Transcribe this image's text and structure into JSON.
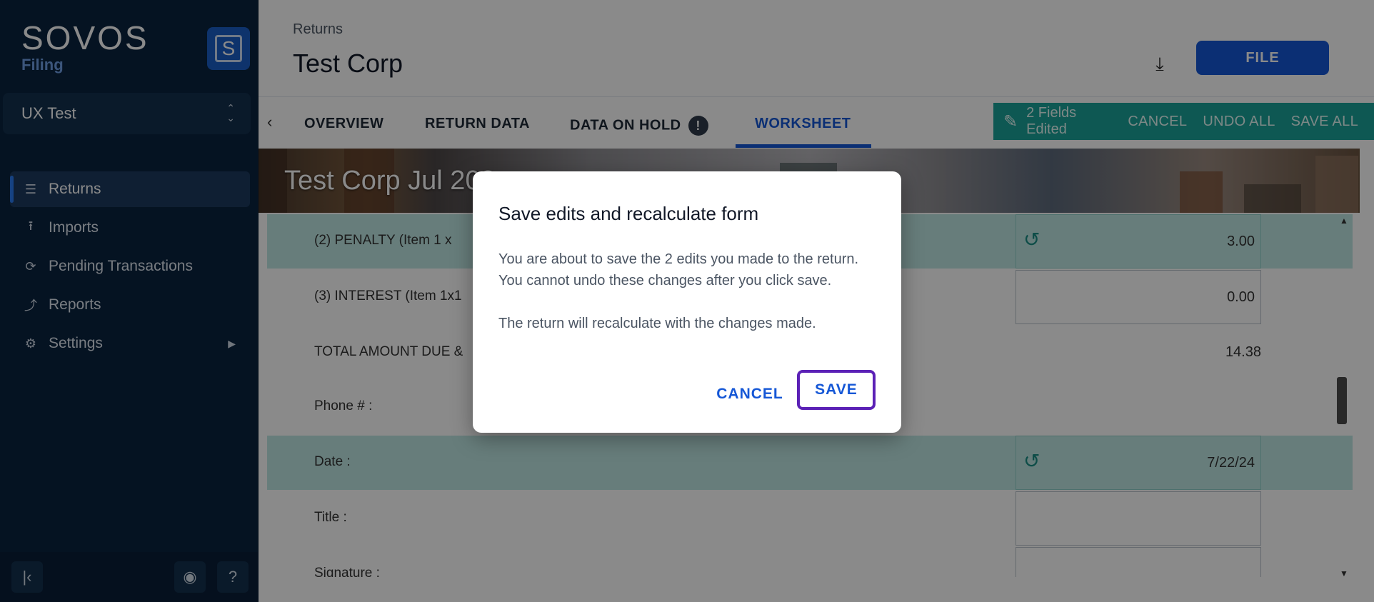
{
  "sidebar": {
    "brand_name": "SOVOS",
    "brand_sub": "Filing",
    "brand_badge": "S",
    "account": "UX Test",
    "items": [
      {
        "label": "Returns",
        "icon": "list-icon"
      },
      {
        "label": "Imports",
        "icon": "upload-icon"
      },
      {
        "label": "Pending Transactions",
        "icon": "sync-icon"
      },
      {
        "label": "Reports",
        "icon": "trend-icon"
      },
      {
        "label": "Settings",
        "icon": "gear-icon"
      }
    ]
  },
  "header": {
    "breadcrumb": "Returns",
    "title": "Test Corp",
    "file_label": "FILE"
  },
  "tabs": [
    "OVERVIEW",
    "RETURN DATA",
    "DATA ON HOLD",
    "WORKSHEET"
  ],
  "edit_bar": {
    "fields_edited": "2 Fields Edited",
    "cancel": "CANCEL",
    "undo_all": "UNDO ALL",
    "save_all": "SAVE ALL"
  },
  "banner": {
    "title": "Test Corp Jul 202"
  },
  "form_rows": [
    {
      "label": "(2) PENALTY (Item 1 x",
      "value": "3.00"
    },
    {
      "label": "(3) INTEREST (Item 1x1",
      "value": "0.00"
    },
    {
      "label": "TOTAL AMOUNT DUE &",
      "value": "14.38"
    },
    {
      "label": "Phone # :",
      "value": ""
    },
    {
      "label": "Date :",
      "value": "7/22/24"
    },
    {
      "label": "Title :",
      "value": ""
    },
    {
      "label": "Signature :",
      "value": ""
    }
  ],
  "modal": {
    "title": "Save edits and recalculate form",
    "body1": "You are about to save the 2 edits you made to the return. You cannot undo these changes after you click save.",
    "body2": "The return will recalculate with the changes made.",
    "cancel": "CANCEL",
    "save": "SAVE"
  },
  "colors": {
    "sidebar_bg": "#0b2340",
    "accent": "#1557d6",
    "edit_bar": "#1aa39a",
    "focus_ring": "#5b21b6"
  }
}
